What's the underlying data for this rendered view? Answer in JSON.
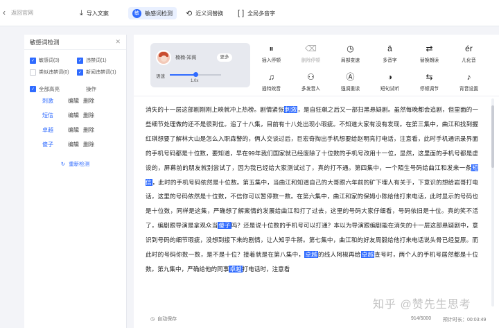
{
  "topbar": {
    "back_label": "返回官网",
    "actions": [
      {
        "label": "导入文案",
        "icon": "import-icon"
      },
      {
        "label": "敏感词检测",
        "icon": "sensitive-check-icon",
        "active": true
      },
      {
        "label": "近义词替换",
        "icon": "synonym-replace-icon"
      },
      {
        "label": "全局多音字",
        "icon": "polyphone-icon"
      }
    ]
  },
  "left_panel": {
    "title": "敏感词检测",
    "categories": [
      {
        "label": "敏感词(3)",
        "checked": true
      },
      {
        "label": "违禁词(1)",
        "checked": true
      },
      {
        "label": "类似违禁词(0)",
        "checked": false
      },
      {
        "label": "新闻违禁词(1)",
        "checked": true
      }
    ],
    "list_header": {
      "select_all": "全部高亮",
      "op": "操作"
    },
    "words": [
      {
        "word": "刺激",
        "edit": "编辑",
        "delete": "删除"
      },
      {
        "word": "短信",
        "edit": "编辑",
        "delete": "删除"
      },
      {
        "word": "卓越",
        "edit": "编辑",
        "delete": "删除"
      },
      {
        "word": "傻子",
        "edit": "编辑",
        "delete": "删除"
      }
    ],
    "recheck": "重新检测"
  },
  "player": {
    "voice_name": "楠楠-知阁",
    "more": "更多",
    "speed_label": "语速",
    "speed_value": "1.0x",
    "speed_level": 0.5
  },
  "tools": [
    {
      "label": "插入停顿",
      "icon": "pause-icon",
      "enabled": true
    },
    {
      "label": "删除停顿",
      "icon": "remove-pause-icon",
      "enabled": false
    },
    {
      "label": "局部变速",
      "icon": "speed-icon",
      "enabled": true
    },
    {
      "label": "多音字",
      "icon": "polyphone-icon",
      "enabled": true
    },
    {
      "label": "替换朗读",
      "icon": "replace-read-icon",
      "enabled": true
    },
    {
      "label": "儿化音",
      "icon": "erhua-icon",
      "enabled": true
    },
    {
      "label": "插特效音",
      "icon": "music-note-icon",
      "enabled": true
    },
    {
      "label": "多发音人",
      "icon": "multi-speaker-icon",
      "enabled": true
    },
    {
      "label": "强调重读",
      "icon": "emphasis-icon",
      "enabled": true
    },
    {
      "label": "短句试听",
      "icon": "preview-icon",
      "enabled": true
    },
    {
      "label": "停顿调节",
      "icon": "pause-adjust-icon",
      "enabled": true
    },
    {
      "label": "背音设置",
      "icon": "background-music-icon",
      "enabled": true
    }
  ],
  "editor": {
    "segments": [
      {
        "t": "消失的十一层这部剧刚刚上映就冲上热榜。剧情紧张"
      },
      {
        "t": "刺激",
        "hl": true
      },
      {
        "t": "，是自狂飙之后又一部扫黑悬疑剧。虽然每晚都会追剧，但里面的一些细节处理做的还不是很到位。追了十八集，目前有十八处出现小瑕疵。不知道大家有没有发现。在第三集中，曲江和找到握红琪想要了解林大山是怎么入职森警的，俩人交谈过后，巨宏奇掏出手机想要给赵明亮打电话，注意看，此时手机通讯录界面的手机号码都是十位数，要知道，早在99年我们国家就已经废除了十位数的手机号改用十一位，显然，这里面的手机号都是虚设的，屏幕前的朋友就别尝试了，因为我已经给大家测试过了，真的打不通。第四集中，一个陌生号码给曲江和发来一条"
      },
      {
        "t": "短信",
        "hl": true
      },
      {
        "t": "，此时的手机号码依然是十位数。第五集中，当曲江和知道自己的大哥跟六年前的矿下埋人有关于，下意识的想给岩哥打电话，这里的号码依然是十位数，不信你可以暂停数一数。在第六集中，曲江和家的保姆小陈给他打来电话，此时显示的号码也是十位数，同样是这集，严确想了解案情的发展给曲江和打了过去，这里的号码大家仔细看，号码依旧是十位。真的笑不活了，编剧跟导演是拿观众当"
      },
      {
        "t": "傻子",
        "hl": true
      },
      {
        "t": "吗？还是说十位数的手机号可以打通？本以为导演跟编剧能在消失的十一层这部悬疑剧中，意识到号码的细节瑕疵，没想到接下来的剧情，让人知乎牛掰。第七集中，曲江和的好友周毅给他打来电话说头骨已经复原。而此时的号码你数一数，是不是十位？接着就是在第八集中，"
      },
      {
        "t": "卓越",
        "hl": true
      },
      {
        "t": "的线人阿椒再给"
      },
      {
        "t": "卓越",
        "hl": true
      },
      {
        "t": "查号时，两个人的手机号居然都是十位数。第九集中，严确给他的同事"
      },
      {
        "t": "卓越",
        "hl": true
      },
      {
        "t": "打电话时，注意看"
      }
    ]
  },
  "footer": {
    "autosave": "自动保存",
    "count": "914/5000",
    "estimate": "预计时长：00:03:49"
  },
  "watermark": "知乎 @赞先生思考"
}
